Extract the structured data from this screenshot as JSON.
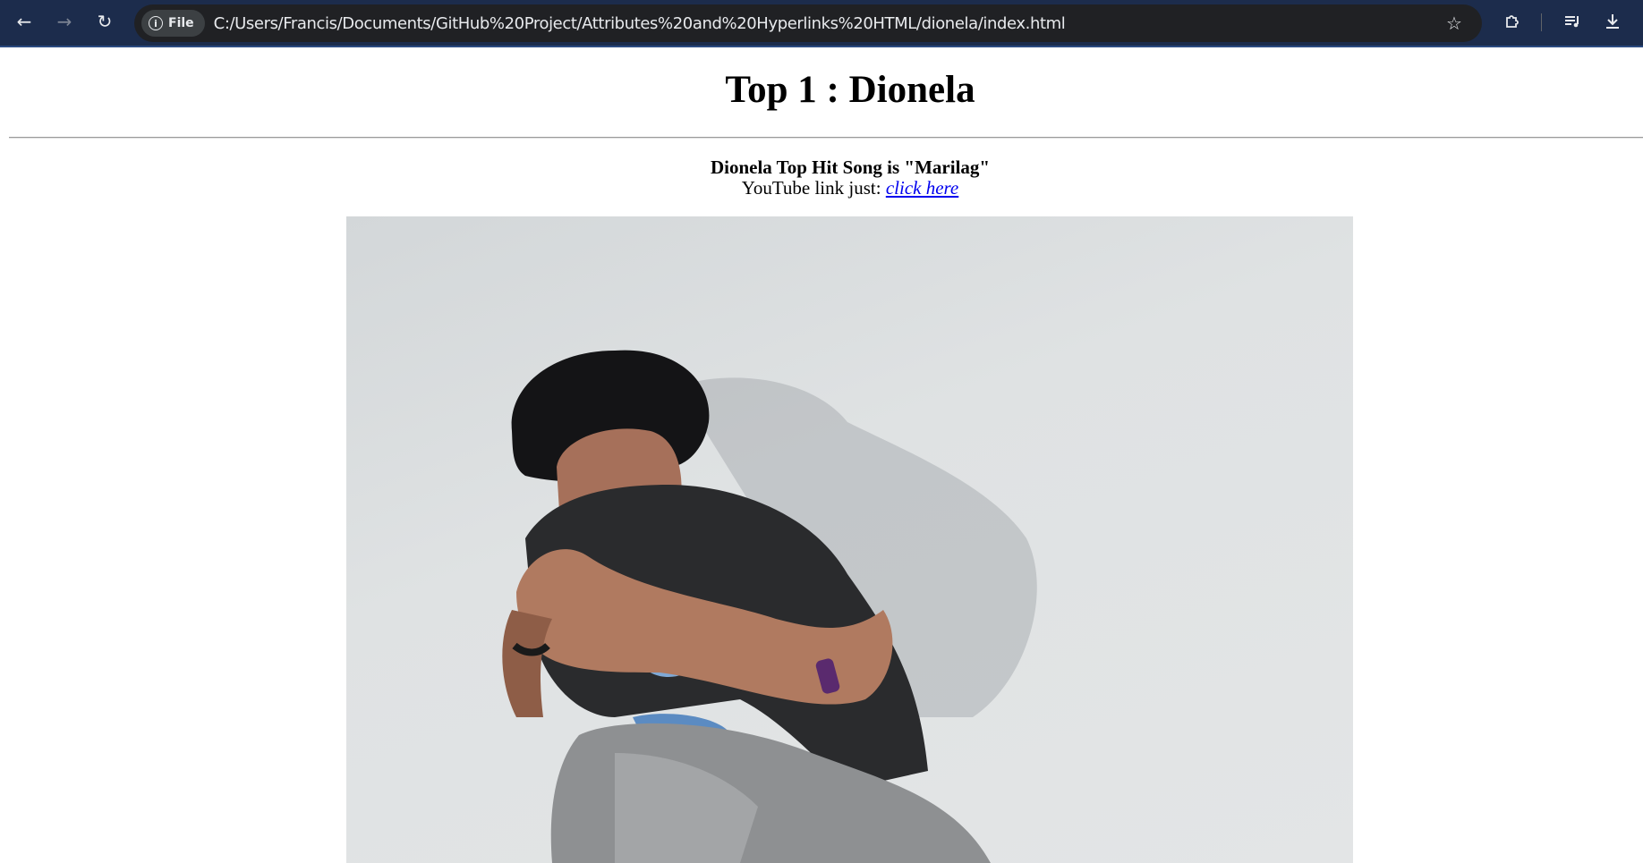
{
  "browser": {
    "back_icon": "arrow-left-icon",
    "forward_icon": "arrow-right-icon",
    "reload_icon": "reload-icon",
    "site_chip_label": "File",
    "url": "C:/Users/Francis/Documents/GitHub%20Project/Attributes%20and%20Hyperlinks%20HTML/dionela/index.html",
    "toolbar_color": "#1c2c4c"
  },
  "page": {
    "title": "Top 1 : Dionela",
    "song_text": "Dionela Top Hit Song is \"Marilag\"",
    "youtube_prefix": "YouTube link just: ",
    "youtube_link": "click here"
  }
}
